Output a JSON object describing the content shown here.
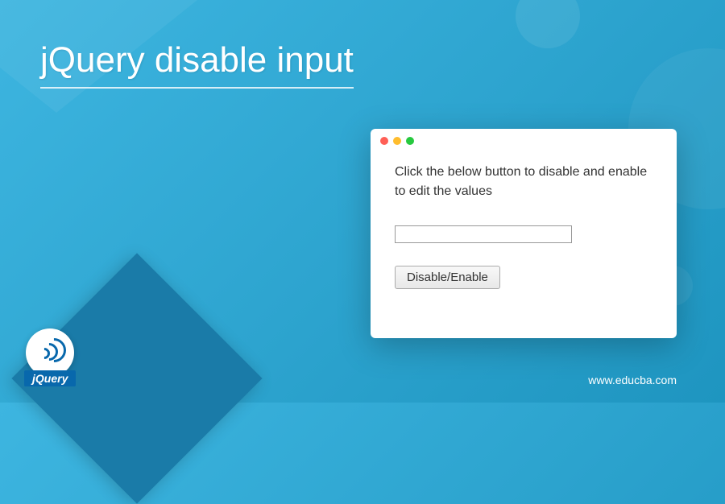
{
  "page": {
    "title": "jQuery disable input",
    "footer_url": "www.educba.com"
  },
  "demo": {
    "instruction": "Click the below button to disable and enable to edit the values",
    "input_value": "",
    "button_label": "Disable/Enable"
  },
  "logo": {
    "text": "jQuery"
  },
  "colors": {
    "bg_primary": "#3db5e0",
    "bg_secondary": "#1e95c0",
    "accent": "#0868ac",
    "window_bg": "#ffffff"
  }
}
